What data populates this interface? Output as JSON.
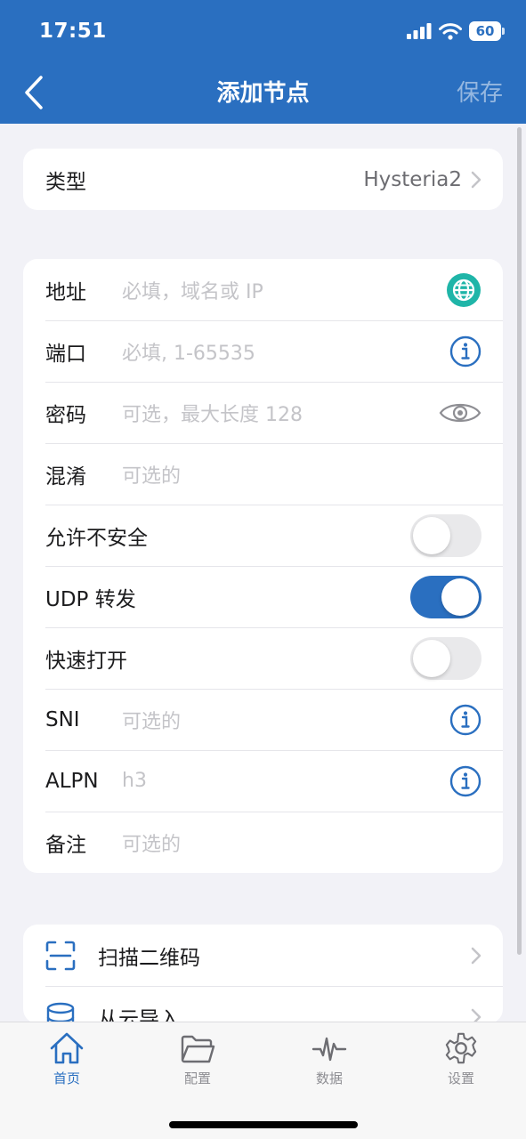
{
  "status_bar": {
    "time": "17:51",
    "battery": "60"
  },
  "nav": {
    "title": "添加节点",
    "save_label": "保存"
  },
  "type_row": {
    "label": "类型",
    "value": "Hysteria2"
  },
  "form": {
    "address": {
      "label": "地址",
      "placeholder": "必填，域名或 IP"
    },
    "port": {
      "label": "端口",
      "placeholder": "必填, 1-65535"
    },
    "password": {
      "label": "密码",
      "placeholder": "可选，最大长度 128"
    },
    "obfs": {
      "label": "混淆",
      "placeholder": "可选的"
    },
    "insecure": {
      "label": "允许不安全",
      "enabled": false
    },
    "udp": {
      "label": "UDP 转发",
      "enabled": true
    },
    "fast_open": {
      "label": "快速打开",
      "enabled": false
    },
    "sni": {
      "label": "SNI",
      "placeholder": "可选的"
    },
    "alpn": {
      "label": "ALPN",
      "placeholder": "h3"
    },
    "remark": {
      "label": "备注",
      "placeholder": "可选的"
    }
  },
  "import_actions": [
    {
      "label": "扫描二维码",
      "icon": "qr-scan-icon"
    },
    {
      "label": "从云导入",
      "icon": "database-icon"
    }
  ],
  "tabbar": {
    "items": [
      {
        "label": "首页",
        "icon": "home-icon",
        "active": true
      },
      {
        "label": "配置",
        "icon": "folder-icon",
        "active": false
      },
      {
        "label": "数据",
        "icon": "activity-icon",
        "active": false
      },
      {
        "label": "设置",
        "icon": "gear-icon",
        "active": false
      }
    ]
  },
  "colors": {
    "accent": "#2a6fc0",
    "globe_icon": "#1fb5a8",
    "background": "#f2f2f7"
  }
}
